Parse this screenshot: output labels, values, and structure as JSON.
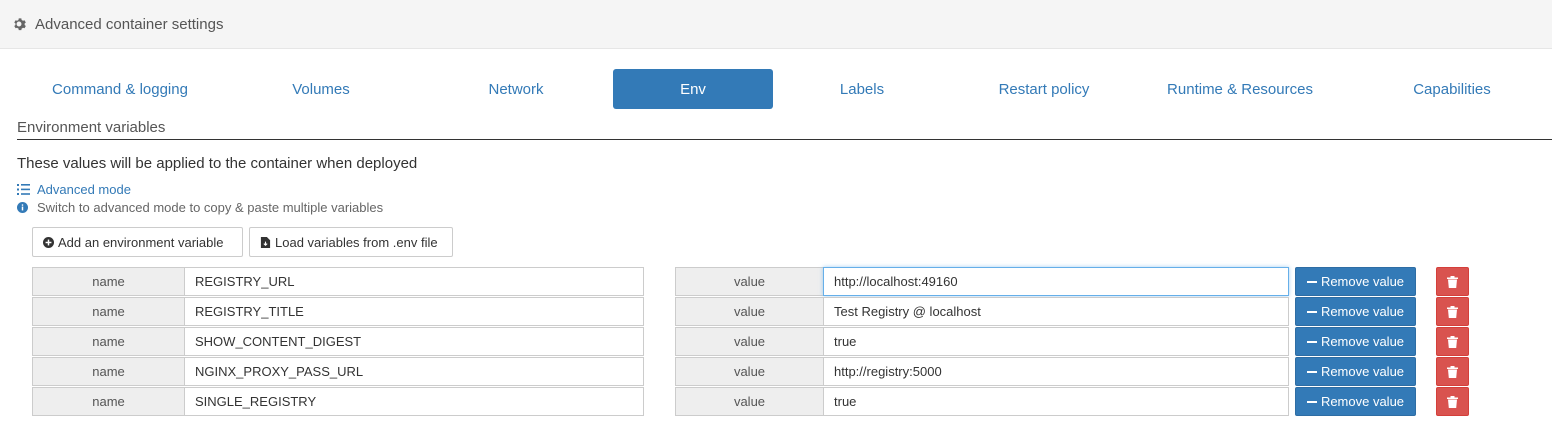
{
  "header": {
    "title": "Advanced container settings",
    "icon": "gear-icon"
  },
  "tabs": [
    {
      "label": "Command & logging"
    },
    {
      "label": "Volumes"
    },
    {
      "label": "Network"
    },
    {
      "label": "Env",
      "active": true
    },
    {
      "label": "Labels"
    },
    {
      "label": "Restart policy"
    },
    {
      "label": "Runtime & Resources"
    },
    {
      "label": "Capabilities"
    }
  ],
  "section": {
    "title": "Environment variables",
    "description": "These values will be applied to the container when deployed",
    "advanced_mode": "Advanced mode",
    "hint": "Switch to advanced mode to copy & paste multiple variables"
  },
  "buttons": {
    "add_variable": "Add an environment variable",
    "load_env": "Load variables from .env file",
    "remove_value": "Remove value"
  },
  "env_vars": [
    {
      "name_label": "name",
      "name": "REGISTRY_URL",
      "value_label": "value",
      "value": "http://localhost:49160"
    },
    {
      "name_label": "name",
      "name": "REGISTRY_TITLE",
      "value_label": "value",
      "value": "Test Registry @ localhost"
    },
    {
      "name_label": "name",
      "name": "SHOW_CONTENT_DIGEST",
      "value_label": "value",
      "value": "true"
    },
    {
      "name_label": "name",
      "name": "NGINX_PROXY_PASS_URL",
      "value_label": "value",
      "value": "http://registry:5000"
    },
    {
      "name_label": "name",
      "name": "SINGLE_REGISTRY",
      "value_label": "value",
      "value": "true"
    }
  ],
  "colors": {
    "primary": "#337ab7",
    "danger": "#d9534f",
    "header_bg": "#f5f5f5"
  }
}
